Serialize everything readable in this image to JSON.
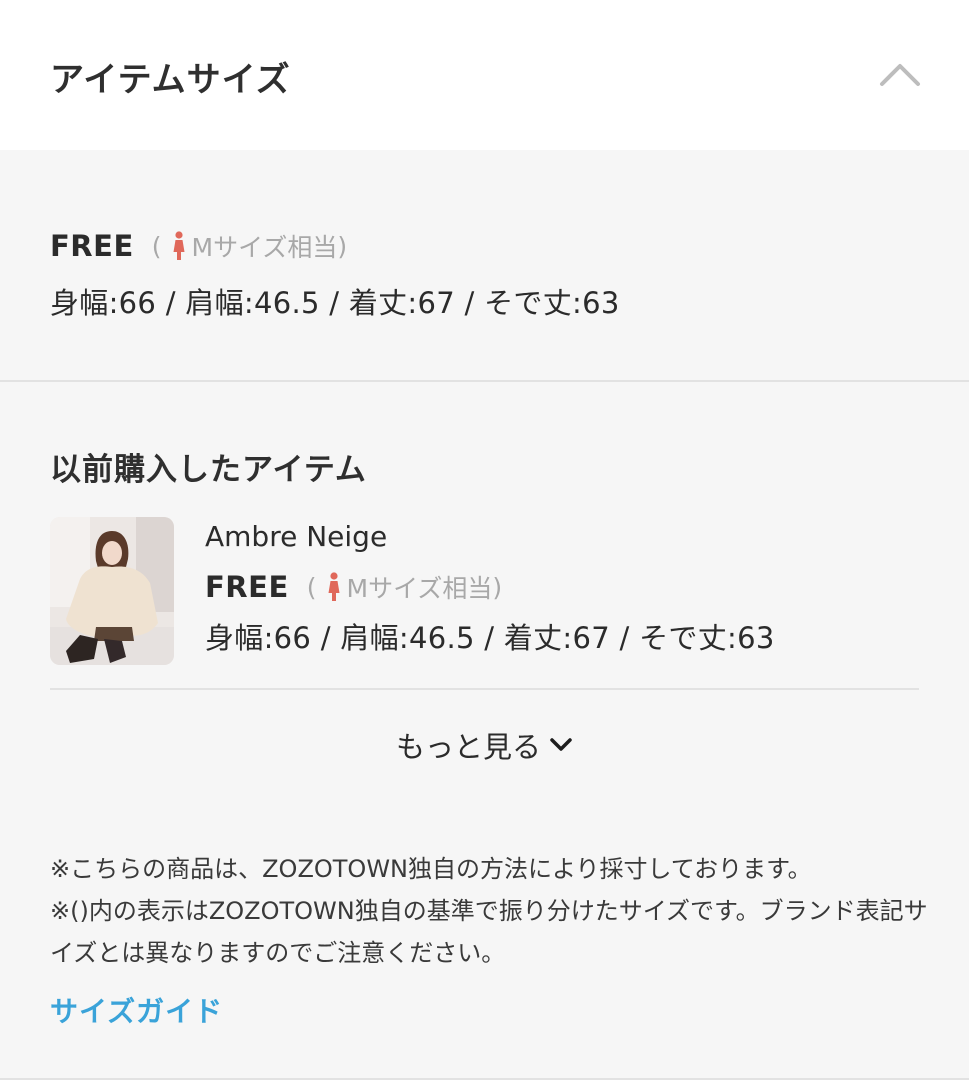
{
  "header": {
    "title": "アイテムサイズ"
  },
  "current_size": {
    "name": "FREE",
    "paren_open": "(",
    "equivalent": "Mサイズ相当",
    "paren_close": ")",
    "measurements": "身幅:66 / 肩幅:46.5 / 着丈:67 / そで丈:63"
  },
  "previous": {
    "title": "以前購入したアイテム",
    "items": [
      {
        "brand": "Ambre Neige",
        "size": "FREE",
        "paren_open": "(",
        "equivalent": "Mサイズ相当",
        "paren_close": ")",
        "measurements": "身幅:66 / 肩幅:46.5 / 着丈:67 / そで丈:63"
      }
    ],
    "more_label": "もっと見る"
  },
  "notes": [
    "※こちらの商品は、ZOZOTOWN独自の方法により採寸しております。",
    "※()内の表示はZOZOTOWN独自の基準で振り分けたサイズです。ブランド表記サイズとは異なりますのでご注意ください。"
  ],
  "guide_label": "サイズガイド",
  "colors": {
    "accent": "#3aa3d9",
    "person_icon": "#e0685a",
    "muted": "#a8a8a8",
    "background": "#f6f6f6"
  },
  "icons": {
    "collapse": "chevron-up-icon",
    "expand_more": "chevron-down-icon",
    "size_equivalent": "female-person-icon"
  }
}
